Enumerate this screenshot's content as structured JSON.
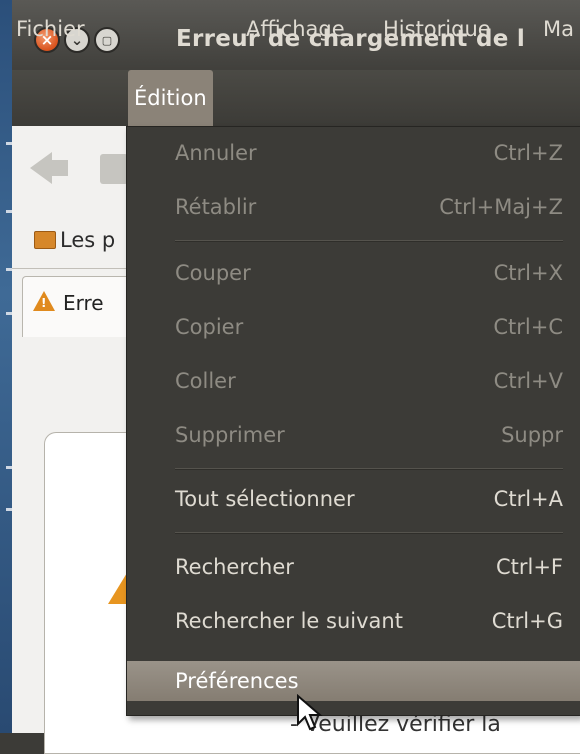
{
  "window": {
    "title": "Erreur de chargement de l"
  },
  "menubar": [
    "Fichier",
    "Édition",
    "Affichage",
    "Historique",
    "Ma"
  ],
  "bookmark": {
    "label": "Les p"
  },
  "tab": {
    "label": "Erre"
  },
  "page": {
    "fragment": "- Veuillez vérifier la"
  },
  "edit_menu": {
    "items": [
      {
        "label": "Annuler",
        "shortcut": "Ctrl+Z",
        "enabled": false
      },
      {
        "label": "Rétablir",
        "shortcut": "Ctrl+Maj+Z",
        "enabled": false
      },
      {
        "label": "Couper",
        "shortcut": "Ctrl+X",
        "enabled": false
      },
      {
        "label": "Copier",
        "shortcut": "Ctrl+C",
        "enabled": false
      },
      {
        "label": "Coller",
        "shortcut": "Ctrl+V",
        "enabled": false
      },
      {
        "label": "Supprimer",
        "shortcut": "Suppr",
        "enabled": false
      },
      {
        "label": "Tout sélectionner",
        "shortcut": "Ctrl+A",
        "enabled": true
      },
      {
        "label": "Rechercher",
        "shortcut": "Ctrl+F",
        "enabled": true
      },
      {
        "label": "Rechercher le suivant",
        "shortcut": "Ctrl+G",
        "enabled": true
      },
      {
        "label": "Préférences",
        "shortcut": "",
        "enabled": true,
        "highlighted": true
      }
    ]
  },
  "colors": {
    "menu_bg": "#3c3b37",
    "highlight": "#8b8378",
    "close_button": "#e0602a"
  }
}
